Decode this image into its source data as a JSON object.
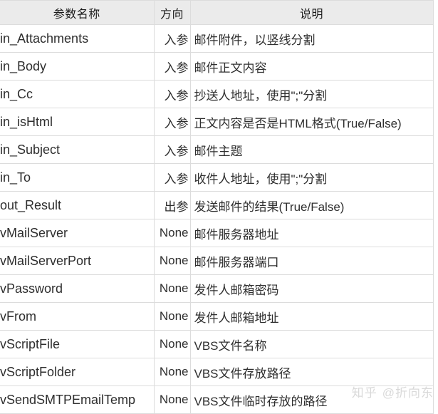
{
  "table": {
    "headers": {
      "name": "参数名称",
      "direction": "方向",
      "description": "说明"
    },
    "rows": [
      {
        "name": "in_Attachments",
        "direction": "入参",
        "description": "邮件附件，以竖线分割"
      },
      {
        "name": "in_Body",
        "direction": "入参",
        "description": "邮件正文内容"
      },
      {
        "name": "in_Cc",
        "direction": "入参",
        "description": "抄送人地址，使用\";\"分割"
      },
      {
        "name": "in_isHtml",
        "direction": "入参",
        "description": "正文内容是否是HTML格式(True/False)"
      },
      {
        "name": "in_Subject",
        "direction": "入参",
        "description": "邮件主题"
      },
      {
        "name": "in_To",
        "direction": "入参",
        "description": "收件人地址，使用\";\"分割"
      },
      {
        "name": "out_Result",
        "direction": "出参",
        "description": "发送邮件的结果(True/False)"
      },
      {
        "name": "vMailServer",
        "direction": "None",
        "description": "邮件服务器地址"
      },
      {
        "name": "vMailServerPort",
        "direction": "None",
        "description": "邮件服务器端口"
      },
      {
        "name": "vPassword",
        "direction": "None",
        "description": "发件人邮箱密码"
      },
      {
        "name": "vFrom",
        "direction": "None",
        "description": "发件人邮箱地址"
      },
      {
        "name": "vScriptFile",
        "direction": "None",
        "description": "VBS文件名称"
      },
      {
        "name": "vScriptFolder",
        "direction": "None",
        "description": "VBS文件存放路径"
      },
      {
        "name": "vSendSMTPEmailTemp",
        "direction": "None",
        "description": "VBS文件临时存放的路径"
      }
    ]
  },
  "watermark": {
    "site": "知乎",
    "author": "@折向东"
  }
}
